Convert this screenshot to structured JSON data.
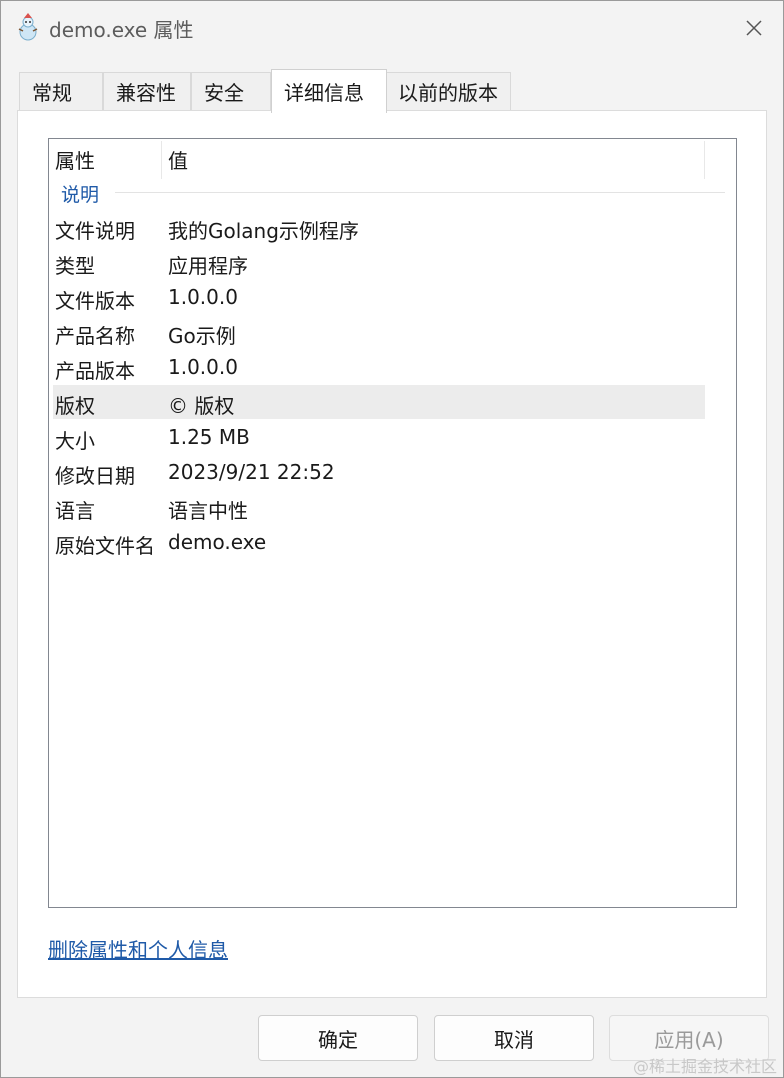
{
  "window": {
    "title": "demo.exe 属性",
    "icons": {
      "app": "app-icon",
      "close": "close-icon"
    }
  },
  "tabs": [
    {
      "label": "常规",
      "active": false
    },
    {
      "label": "兼容性",
      "active": false
    },
    {
      "label": "安全",
      "active": false
    },
    {
      "label": "详细信息",
      "active": true
    },
    {
      "label": "以前的版本",
      "active": false
    }
  ],
  "details": {
    "columns": {
      "property": "属性",
      "value": "值"
    },
    "group": "说明",
    "rows": [
      {
        "property": "文件说明",
        "value": "我的Golang示例程序"
      },
      {
        "property": "类型",
        "value": "应用程序"
      },
      {
        "property": "文件版本",
        "value": "1.0.0.0"
      },
      {
        "property": "产品名称",
        "value": "Go示例"
      },
      {
        "property": "产品版本",
        "value": "1.0.0.0"
      },
      {
        "property": "版权",
        "value": "© 版权",
        "selected": true
      },
      {
        "property": "大小",
        "value": "1.25 MB"
      },
      {
        "property": "修改日期",
        "value": "2023/9/21 22:52"
      },
      {
        "property": "语言",
        "value": "语言中性"
      },
      {
        "property": "原始文件名",
        "value": "demo.exe"
      }
    ]
  },
  "remove_link": "删除属性和个人信息",
  "buttons": {
    "ok": "确定",
    "cancel": "取消",
    "apply": "应用(A)"
  },
  "watermark": "@稀土掘金技术社区",
  "colors": {
    "link": "#1f5aa8",
    "selected_row": "#ececec"
  }
}
